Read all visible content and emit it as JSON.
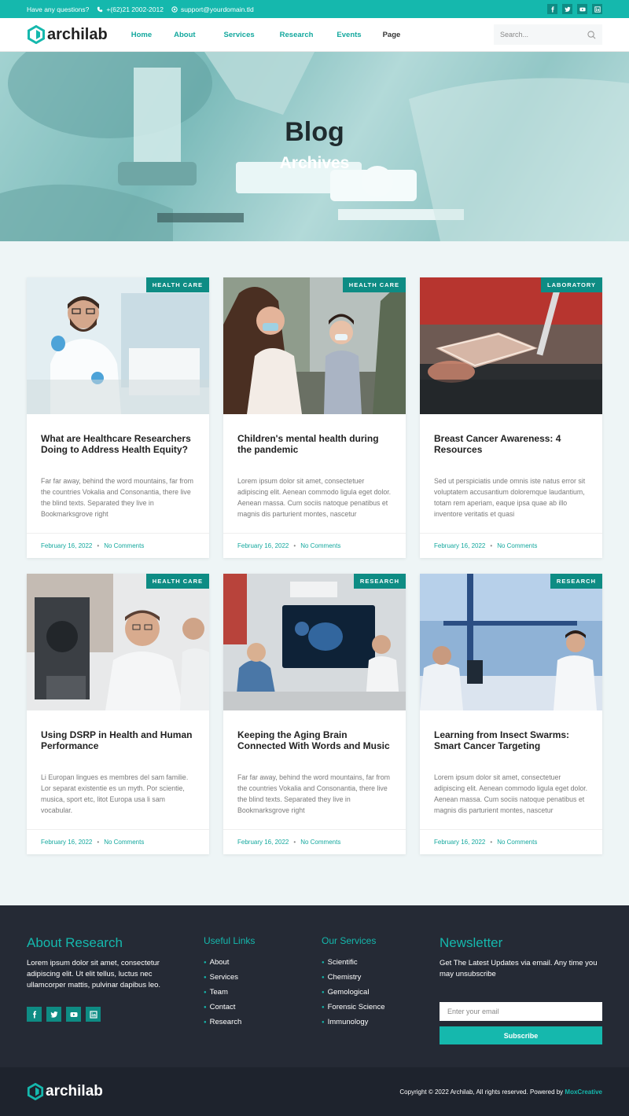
{
  "topbar": {
    "question": "Have any questions?",
    "phone": "+(62)21 2002-2012",
    "email": "support@yourdomain.tld"
  },
  "brand": {
    "name": "archilab"
  },
  "nav": {
    "items": [
      "Home",
      "About",
      "Services",
      "Research",
      "Events",
      "Page"
    ],
    "search_placeholder": "Search..."
  },
  "hero": {
    "title": "Blog",
    "subtitle": "Archives"
  },
  "posts": [
    {
      "tag": "HEALTH CARE",
      "title": "What are Healthcare Researchers Doing to Address Health Equity?",
      "excerpt": "Far far away, behind the word mountains, far from the countries Vokalia and Consonantia, there live the blind texts. Separated they live in Bookmarksgrove right",
      "date": "February 16, 2022",
      "comments": "No Comments"
    },
    {
      "tag": "HEALTH CARE",
      "title": "Children's mental health during the pandemic",
      "excerpt": "Lorem ipsum dolor sit amet, consectetuer adipiscing elit. Aenean commodo ligula eget dolor. Aenean massa. Cum sociis natoque penatibus et magnis dis parturient montes, nascetur",
      "date": "February 16, 2022",
      "comments": "No Comments"
    },
    {
      "tag": "LABORATORY",
      "title": "Breast Cancer Awareness: 4 Resources",
      "excerpt": "Sed ut perspiciatis unde omnis iste natus error sit voluptatem accusantium doloremque laudantium, totam rem aperiam, eaque ipsa quae ab illo inventore veritatis et quasi",
      "date": "February 16, 2022",
      "comments": "No Comments"
    },
    {
      "tag": "HEALTH CARE",
      "title": "Using DSRP in Health and Human Performance",
      "excerpt": "Li Europan lingues es membres del sam familie. Lor separat existentie es un myth. Por scientie, musica, sport etc, litot Europa usa li sam vocabular.",
      "date": "February 16, 2022",
      "comments": "No Comments"
    },
    {
      "tag": "RESEARCH",
      "title": "Keeping the Aging Brain Connected With Words and Music",
      "excerpt": "Far far away, behind the word mountains, far from the countries Vokalia and Consonantia, there live the blind texts. Separated they live in Bookmarksgrove right",
      "date": "February 16, 2022",
      "comments": "No Comments"
    },
    {
      "tag": "RESEARCH",
      "title": "Learning from Insect Swarms: Smart Cancer Targeting",
      "excerpt": "Lorem ipsum dolor sit amet, consectetuer adipiscing elit. Aenean commodo ligula eget dolor. Aenean massa. Cum sociis natoque penatibus et magnis dis parturient montes, nascetur",
      "date": "February 16, 2022",
      "comments": "No Comments"
    }
  ],
  "footer": {
    "about_title": "About Research",
    "about_text": "Lorem ipsum dolor sit amet, consectetur adipiscing elit. Ut elit tellus, luctus nec ullamcorper mattis, pulvinar dapibus leo.",
    "links_title": "Useful Links",
    "links": [
      "About",
      "Services",
      "Team",
      "Contact",
      "Research"
    ],
    "services_title": "Our Services",
    "services": [
      "Scientific",
      "Chemistry",
      "Gemological",
      "Forensic Science",
      "Immunology"
    ],
    "newsletter_title": "Newsletter",
    "newsletter_text": "Get The Latest Updates via email. Any time you may unsubscribe",
    "email_placeholder": "Enter your email",
    "subscribe_label": "Subscribe"
  },
  "bottom": {
    "copyright": "Copyright © 2022 Archilab, All rights reserved. Powered by",
    "powered": "MoxCreative"
  },
  "colors": {
    "accent": "#15b8ad",
    "accent_dark": "#0e8c84",
    "footer_bg": "#252a35"
  }
}
